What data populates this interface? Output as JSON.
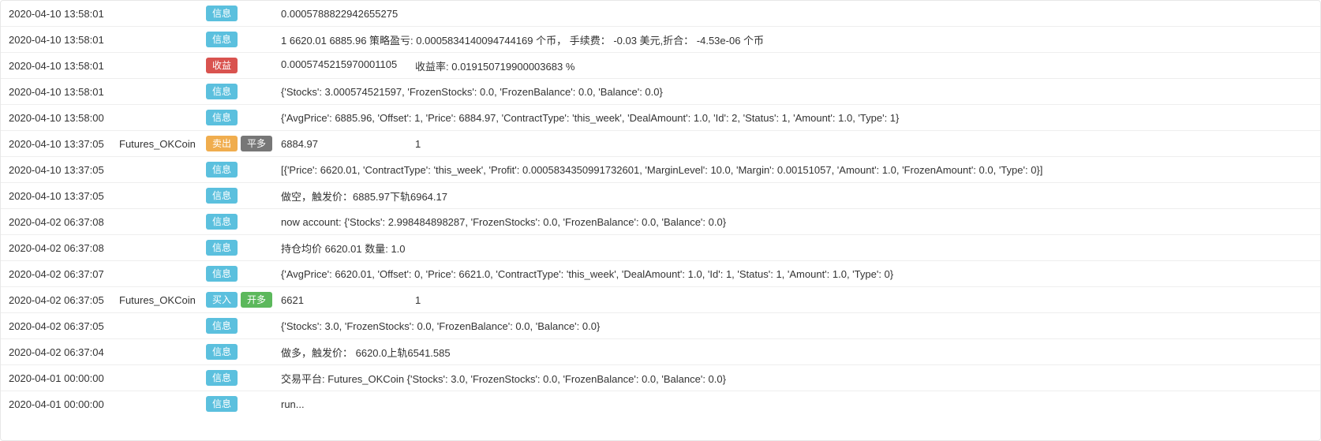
{
  "tag_labels": {
    "info": "信息",
    "profit": "收益",
    "sell": "卖出",
    "close_long": "平多",
    "buy": "买入",
    "open_long": "开多"
  },
  "rows": [
    {
      "time": "2020-04-10 13:58:01",
      "exchange": "",
      "tags": [
        {
          "type": "info",
          "label_key": "info"
        }
      ],
      "msg": "0.0005788822942655275"
    },
    {
      "time": "2020-04-10 13:58:01",
      "exchange": "",
      "tags": [
        {
          "type": "info",
          "label_key": "info"
        }
      ],
      "msg": "1 6620.01 6885.96 策略盈亏: 0.0005834140094744169 个币， 手续费： -0.03 美元,折合： -4.53e-06 个币"
    },
    {
      "time": "2020-04-10 13:58:01",
      "exchange": "",
      "tags": [
        {
          "type": "danger",
          "label_key": "profit"
        }
      ],
      "msg_part1": "0.0005745215970001105",
      "msg_part2": "收益率: 0.019150719900003683 %"
    },
    {
      "time": "2020-04-10 13:58:01",
      "exchange": "",
      "tags": [
        {
          "type": "info",
          "label_key": "info"
        }
      ],
      "msg": "{'Stocks': 3.000574521597, 'FrozenStocks': 0.0, 'FrozenBalance': 0.0, 'Balance': 0.0}"
    },
    {
      "time": "2020-04-10 13:58:00",
      "exchange": "",
      "tags": [
        {
          "type": "info",
          "label_key": "info"
        }
      ],
      "msg": "{'AvgPrice': 6885.96, 'Offset': 1, 'Price': 6884.97, 'ContractType': 'this_week', 'DealAmount': 1.0, 'Id': 2, 'Status': 1, 'Amount': 1.0, 'Type': 1}"
    },
    {
      "time": "2020-04-10 13:37:05",
      "exchange": "Futures_OKCoin",
      "tags": [
        {
          "type": "warning",
          "label_key": "sell"
        },
        {
          "type": "gray",
          "label_key": "close_long"
        }
      ],
      "msg_part1": "6884.97",
      "msg_part2": "1"
    },
    {
      "time": "2020-04-10 13:37:05",
      "exchange": "",
      "tags": [
        {
          "type": "info",
          "label_key": "info"
        }
      ],
      "msg": "[{'Price': 6620.01, 'ContractType': 'this_week', 'Profit': 0.0005834350991732601, 'MarginLevel': 10.0, 'Margin': 0.00151057, 'Amount': 1.0, 'FrozenAmount': 0.0, 'Type': 0}]"
    },
    {
      "time": "2020-04-10 13:37:05",
      "exchange": "",
      "tags": [
        {
          "type": "info",
          "label_key": "info"
        }
      ],
      "msg": "做空，触发价：6885.97下轨6964.17"
    },
    {
      "time": "2020-04-02 06:37:08",
      "exchange": "",
      "tags": [
        {
          "type": "info",
          "label_key": "info"
        }
      ],
      "msg": "now account: {'Stocks': 2.998484898287, 'FrozenStocks': 0.0, 'FrozenBalance': 0.0, 'Balance': 0.0}"
    },
    {
      "time": "2020-04-02 06:37:08",
      "exchange": "",
      "tags": [
        {
          "type": "info",
          "label_key": "info"
        }
      ],
      "msg": "持仓均价 6620.01 数量: 1.0"
    },
    {
      "time": "2020-04-02 06:37:07",
      "exchange": "",
      "tags": [
        {
          "type": "info",
          "label_key": "info"
        }
      ],
      "msg": "{'AvgPrice': 6620.01, 'Offset': 0, 'Price': 6621.0, 'ContractType': 'this_week', 'DealAmount': 1.0, 'Id': 1, 'Status': 1, 'Amount': 1.0, 'Type': 0}"
    },
    {
      "time": "2020-04-02 06:37:05",
      "exchange": "Futures_OKCoin",
      "tags": [
        {
          "type": "info",
          "label_key": "buy"
        },
        {
          "type": "success",
          "label_key": "open_long"
        }
      ],
      "msg_part1": "6621",
      "msg_part2": "1"
    },
    {
      "time": "2020-04-02 06:37:05",
      "exchange": "",
      "tags": [
        {
          "type": "info",
          "label_key": "info"
        }
      ],
      "msg": "{'Stocks': 3.0, 'FrozenStocks': 0.0, 'FrozenBalance': 0.0, 'Balance': 0.0}"
    },
    {
      "time": "2020-04-02 06:37:04",
      "exchange": "",
      "tags": [
        {
          "type": "info",
          "label_key": "info"
        }
      ],
      "msg": "做多，触发价： 6620.0上轨6541.585"
    },
    {
      "time": "2020-04-01 00:00:00",
      "exchange": "",
      "tags": [
        {
          "type": "info",
          "label_key": "info"
        }
      ],
      "msg": "交易平台: Futures_OKCoin {'Stocks': 3.0, 'FrozenStocks': 0.0, 'FrozenBalance': 0.0, 'Balance': 0.0}"
    },
    {
      "time": "2020-04-01 00:00:00",
      "exchange": "",
      "tags": [
        {
          "type": "info",
          "label_key": "info"
        }
      ],
      "msg": "run..."
    }
  ]
}
